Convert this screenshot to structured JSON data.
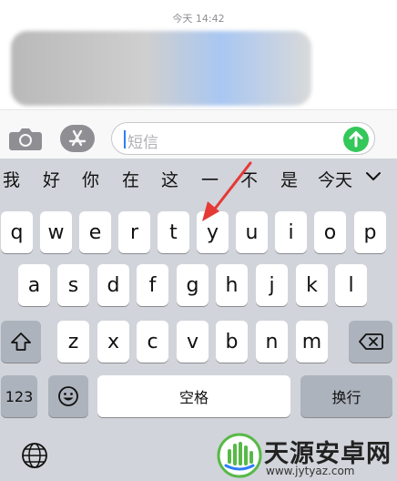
{
  "conversation": {
    "timestamp": "今天 14:42"
  },
  "composer": {
    "camera_icon": "camera-icon",
    "apps_icon": "app-store-icon",
    "placeholder": "短信",
    "send_icon": "send-arrow-icon"
  },
  "keyboard": {
    "candidates": [
      "我",
      "好",
      "你",
      "在",
      "这",
      "一",
      "不",
      "是",
      "今天"
    ],
    "expand_icon": "chevron-down-icon",
    "row1": [
      "q",
      "w",
      "e",
      "r",
      "t",
      "y",
      "u",
      "i",
      "o",
      "p"
    ],
    "row2": [
      "a",
      "s",
      "d",
      "f",
      "g",
      "h",
      "j",
      "k",
      "l"
    ],
    "row3": [
      "z",
      "x",
      "c",
      "v",
      "b",
      "n",
      "m"
    ],
    "shift_icon": "shift-icon",
    "delete_icon": "delete-icon",
    "numbers_label": "123",
    "emoji_icon": "emoji-icon",
    "space_label": "空格",
    "return_label": "换行",
    "globe_icon": "globe-icon"
  },
  "annotation": {
    "arrow_color": "#e53935"
  },
  "watermark": {
    "title": "天源安卓网",
    "url": "www.jytyaz.com"
  },
  "colors": {
    "keyboard_bg": "#d1d4da",
    "key_bg": "#ffffff",
    "function_key_bg": "#adb3bc",
    "send_button": "#34c759",
    "caret": "#2f7cf6"
  }
}
